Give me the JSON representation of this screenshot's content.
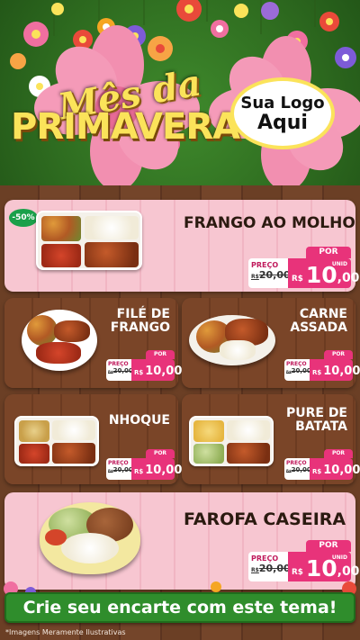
{
  "header": {
    "title_line1": "Mês da",
    "title_line2": "PRIMAVERA",
    "logo_line1": "Sua Logo",
    "logo_line2": "Aqui"
  },
  "labels": {
    "por": "POR",
    "preco": "PREÇO",
    "unid": "UNID",
    "currency": "R$",
    "currency_small": "R$"
  },
  "products": [
    {
      "name": "FRANGO AO MOLHO",
      "old_price": "20,00",
      "new_int": "10",
      "new_dec": ",00",
      "badge": "-50%"
    },
    {
      "name_line1": "FILÉ DE",
      "name_line2": "FRANGO",
      "old_price": "20,00",
      "new_price": "10,00"
    },
    {
      "name_line1": "CARNE",
      "name_line2": "ASSADA",
      "old_price": "20,00",
      "new_price": "10,00"
    },
    {
      "name": "NHOQUE",
      "old_price": "20,00",
      "new_price": "10,00"
    },
    {
      "name_line1": "PURE DE",
      "name_line2": "BATATA",
      "old_price": "20,00",
      "new_price": "10,00"
    },
    {
      "name": "FAROFA CASEIRA",
      "old_price": "20,00",
      "new_int": "10",
      "new_dec": ",00"
    }
  ],
  "cta": "Crie seu encarte com este tema!",
  "disclaimer": "*Imagens Meramente Ilustrativas",
  "colors": {
    "accent_pink": "#e8337a",
    "title_yellow": "#fbe35a",
    "cta_green": "#2f8d2c",
    "discount_green": "#1aa04a"
  }
}
